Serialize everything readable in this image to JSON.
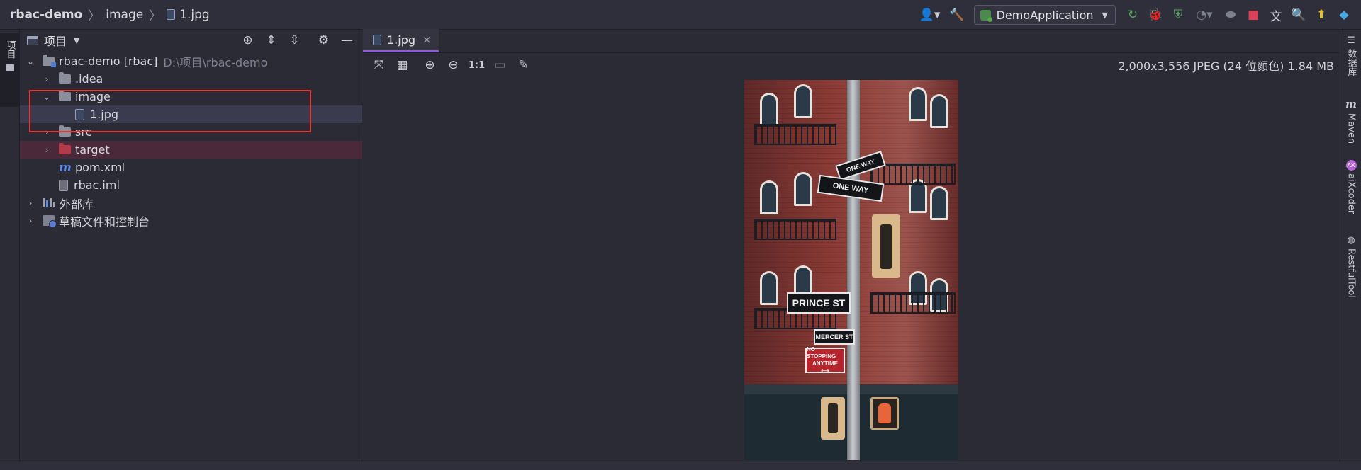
{
  "breadcrumb": {
    "project": "rbac-demo",
    "folder": "image",
    "file": "1.jpg"
  },
  "toolbar": {
    "run_config": "DemoApplication"
  },
  "project_panel": {
    "title": "项目",
    "tree": [
      {
        "label": "rbac-demo [rbac]",
        "path": "D:\\项目\\rbac-demo"
      },
      {
        "label": ".idea"
      },
      {
        "label": "image"
      },
      {
        "label": "1.jpg"
      },
      {
        "label": "src"
      },
      {
        "label": "target"
      },
      {
        "label": "pom.xml"
      },
      {
        "label": "rbac.iml"
      },
      {
        "label": "外部库"
      },
      {
        "label": "草稿文件和控制台"
      }
    ]
  },
  "left_stripe": {
    "project_tab": "项目"
  },
  "editor": {
    "tab": {
      "label": "1.jpg",
      "close": "×"
    },
    "zoom_actual": "1:1",
    "image_info": "2,000x3,556 JPEG (24 位颜色) 1.84 MB"
  },
  "photo": {
    "sign_top": "ONE WAY",
    "sign_mid": "ONE WAY",
    "street_1": "PRINCE ST",
    "street_2": "MERCER ST",
    "no_stop_1": "NO STOPPING",
    "no_stop_2": "ANYTIME",
    "no_stop_arrow": "⟷"
  },
  "right_stripe": {
    "database": "数据库",
    "maven": "Maven",
    "aixcoder": "aiXcoder",
    "restful": "RestfulTool"
  },
  "colors": {
    "accent": "#8c5bd6",
    "highlight_box": "#e53935",
    "excluded_folder": "#b33a48"
  }
}
